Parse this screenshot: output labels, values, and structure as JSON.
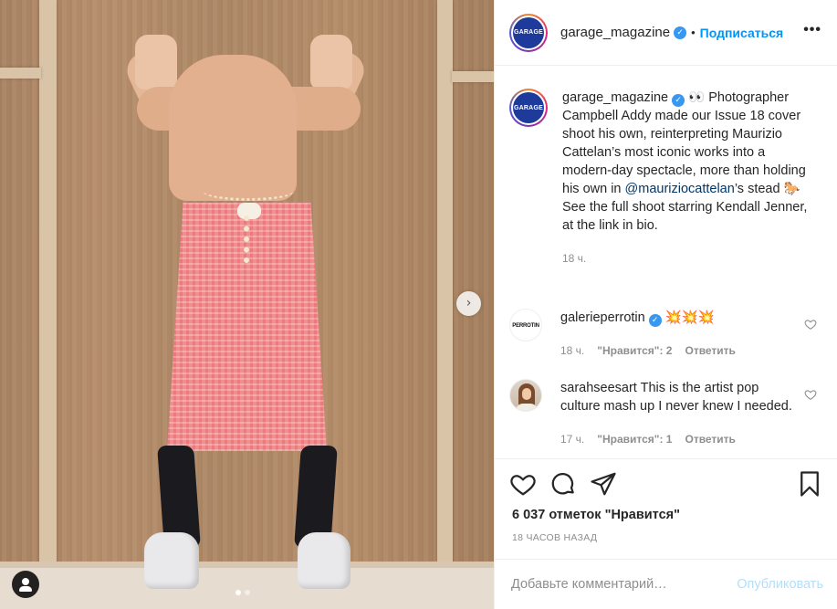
{
  "header": {
    "username": "garage_magazine",
    "separator": "•",
    "follow_label": "Подписаться",
    "more_label": "•••",
    "avatar_text": "GARAGE"
  },
  "caption": {
    "username": "garage_magazine",
    "text_before_mention": "👀 Photographer Campbell Addy made our Issue 18 cover shoot his own, reinterpreting Maurizio Cattelan’s most iconic works into a modern-day spectacle, more than holding his own in ",
    "mention": "@mauriziocattelan",
    "text_after_mention": "’s stead 🐎 See the full shoot starring Kendall Jenner, at the link in bio.",
    "time": "18 ч."
  },
  "comments": [
    {
      "username": "galerieperrotin",
      "avatar_text": "PERROTIN",
      "text": "💥💥💥",
      "time": "18 ч.",
      "likes": "\"Нравится\": 2",
      "reply": "Ответить",
      "verified": true
    },
    {
      "username": "sarahseesart",
      "text": "This is the artist pop culture mash up I never knew I needed.",
      "time": "17 ч.",
      "likes": "\"Нравится\": 1",
      "reply": "Ответить"
    }
  ],
  "actions": {
    "likes_text": "6 037 отметок \"Нравится\"",
    "posted_text": "18 ЧАСОВ НАЗАД"
  },
  "composer": {
    "placeholder": "Добавьте комментарий…",
    "publish_label": "Опубликовать"
  },
  "carousel": {
    "next_label": "›",
    "total": 2,
    "current": 1
  },
  "colors": {
    "accent": "#0095f6",
    "verified": "#3897f0",
    "muted": "#8e8e8e",
    "publish_disabled": "#b2dffc"
  }
}
